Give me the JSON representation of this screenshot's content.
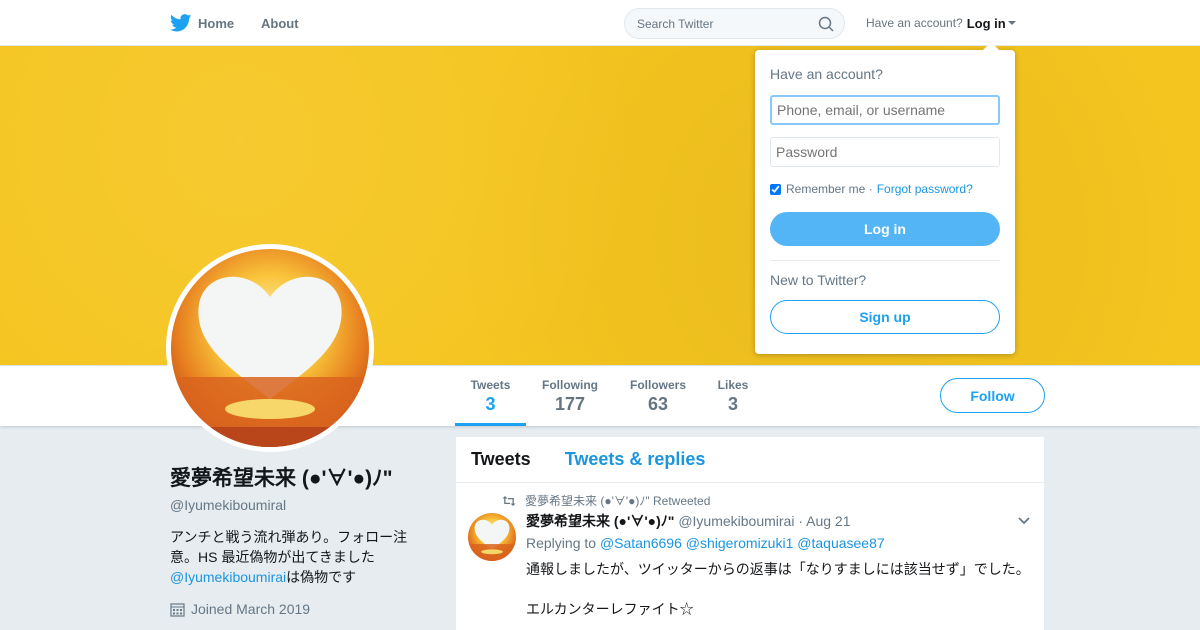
{
  "topbar": {
    "home_label": "Home",
    "about_label": "About",
    "search_placeholder": "Search Twitter",
    "have_account": "Have an account?",
    "login_label": "Log in"
  },
  "profile": {
    "display_name": "愛夢希望未来 (●'∀'●)ﾉ\"",
    "handle": "@Iyumekiboumiral",
    "bio_text": "アンチと戦う流れ弾あり。フォロー注意。HS 最近偽物が出てきました",
    "bio_link": "@Iyumekiboumirai",
    "bio_suffix": "は偽物です",
    "joined": "Joined March 2019"
  },
  "stats": [
    {
      "label": "Tweets",
      "value": "3"
    },
    {
      "label": "Following",
      "value": "177"
    },
    {
      "label": "Followers",
      "value": "63"
    },
    {
      "label": "Likes",
      "value": "3"
    }
  ],
  "follow_label": "Follow",
  "timeline": {
    "tabs": [
      "Tweets",
      "Tweets & replies"
    ],
    "tweet": {
      "retweeted_by": "愛夢希望未来 (●'∀'●)ﾉ\" Retweeted",
      "name": "愛夢希望未来 (●'∀'●)ﾉ\"",
      "handle": "@Iyumekiboumirai",
      "date": "· Aug 21",
      "replying_to": "Replying to",
      "mentions": [
        "@Satan6696",
        "@shigeromizuki1",
        "@taquasee87"
      ],
      "text": "通報しましたが、ツイッターからの返事は「なりすましには該当せず」でした。\n\nエルカンターレファイト☆"
    }
  },
  "login_box": {
    "title": "Have an account?",
    "username_placeholder": "Phone, email, or username",
    "password_placeholder": "Password",
    "remember": "Remember me",
    "forgot": "Forgot password?",
    "login_button": "Log in",
    "new_to": "New to Twitter?",
    "signup": "Sign up"
  },
  "colors": {
    "accent": "#1da1f2",
    "banner": "#f5c51f"
  }
}
